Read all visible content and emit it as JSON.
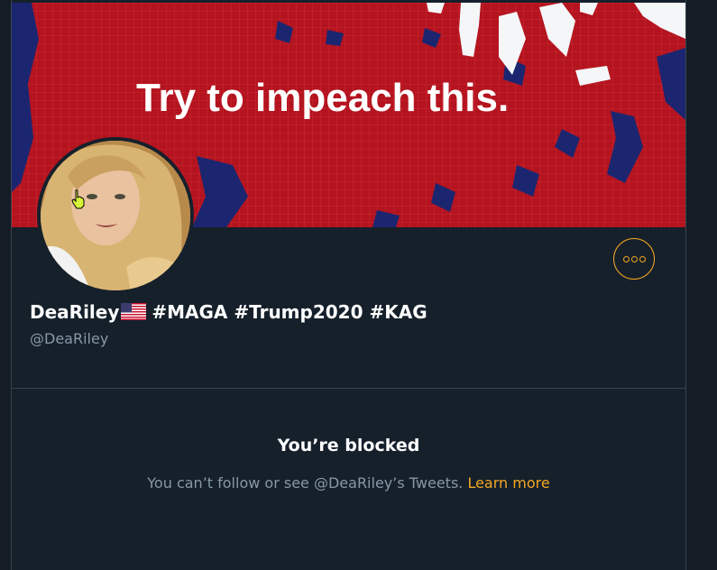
{
  "banner": {
    "text": "Try to impeach this.",
    "colors": {
      "red": "#b3141f",
      "blue": "#1c2670",
      "water": "#ffffff"
    }
  },
  "profile": {
    "display_name": "DeaRiley",
    "flag_icon": "us-flag-icon",
    "hashtags": "#MAGA #Trump2020 #KAG",
    "handle": "@DeaRiley"
  },
  "actions": {
    "more_icon": "more-options-icon"
  },
  "blocked": {
    "title": "You’re blocked",
    "message": "You can’t follow or see @DeaRiley’s Tweets.",
    "link_label": "Learn more"
  },
  "colors": {
    "background": "#15202b",
    "accent": "#f5a623",
    "secondary_text": "#8899a6",
    "border": "#38444d"
  }
}
